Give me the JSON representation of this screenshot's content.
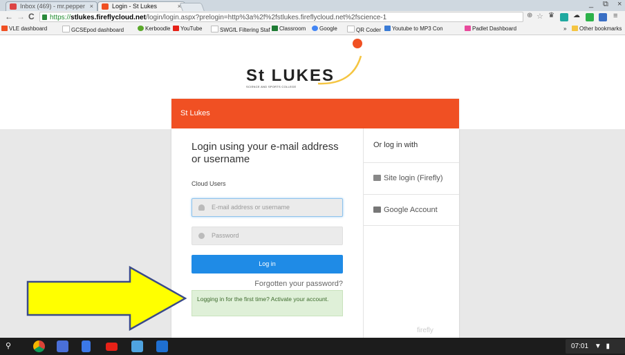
{
  "browser": {
    "tabs": [
      {
        "label": "Inbox (469) - mr.pepper",
        "close": "×",
        "active": false
      },
      {
        "label": "Login - St Lukes",
        "close": "×",
        "active": true
      }
    ],
    "window_controls": {
      "minimize": "_",
      "restore": "⧉",
      "close": "×"
    },
    "address": {
      "scheme": "https://",
      "host": "stlukes.fireflycloud.net",
      "path": "/login/login.aspx?prelogin=http%3a%2f%2fstlukes.fireflycloud.net%2fscience-1"
    },
    "nav": {
      "back": "←",
      "forward": "→",
      "reload": "C"
    },
    "bookmarks": [
      {
        "label": "VLE dashboard",
        "icon": "firefly-icon",
        "color": "#f05023"
      },
      {
        "label": "GCSEpod dashboard",
        "icon": "page-icon",
        "color": "#dddddd"
      },
      {
        "label": "Kerboodle",
        "icon": "kerboodle-icon",
        "color": "#5aa82a"
      },
      {
        "label": "YouTube",
        "icon": "youtube-icon",
        "color": "#e62117"
      },
      {
        "label": "SWGfL Filtering Staf",
        "icon": "page-icon",
        "color": "#dddddd"
      },
      {
        "label": "Classroom",
        "icon": "classroom-icon",
        "color": "#1e7b34"
      },
      {
        "label": "Google",
        "icon": "google-icon",
        "color": "#4285f4"
      },
      {
        "label": "QR Coder",
        "icon": "page-icon",
        "color": "#dddddd"
      },
      {
        "label": "Youtube to MP3 Con",
        "icon": "mp3-icon",
        "color": "#3a7bd5"
      },
      {
        "label": "Padlet Dashboard",
        "icon": "padlet-icon",
        "color": "#e84a9c"
      }
    ],
    "bookmarks_overflow": "»",
    "other_bookmarks": "Other bookmarks"
  },
  "page": {
    "logo_text": "St LUKES",
    "logo_sub": "SCIENCE AND SPORTS COLLEGE",
    "card_header": "St Lukes",
    "login_title": "Login using your e-mail address or username",
    "cloud_users": "Cloud Users",
    "email_placeholder": "E-mail address or username",
    "password_placeholder": "Password",
    "login_button": "Log in",
    "forgot": "Forgotten your password?",
    "first_time": "Logging in for the first time? Activate your account.",
    "or_log_in_with": "Or log in with",
    "site_login": "Site login (Firefly)",
    "google_account": "Google Account",
    "firefly_mark": "firefly"
  },
  "shelf": {
    "time": "07:01",
    "apps": [
      "search-icon",
      "chrome-icon",
      "google-plus-icon",
      "docs-icon",
      "youtube-icon",
      "files-icon",
      "photos-icon"
    ]
  },
  "colors": {
    "brand": "#f05023",
    "login_button": "#1f8be6",
    "success_bg": "#dff0d8",
    "arrow": "#ffff00"
  }
}
